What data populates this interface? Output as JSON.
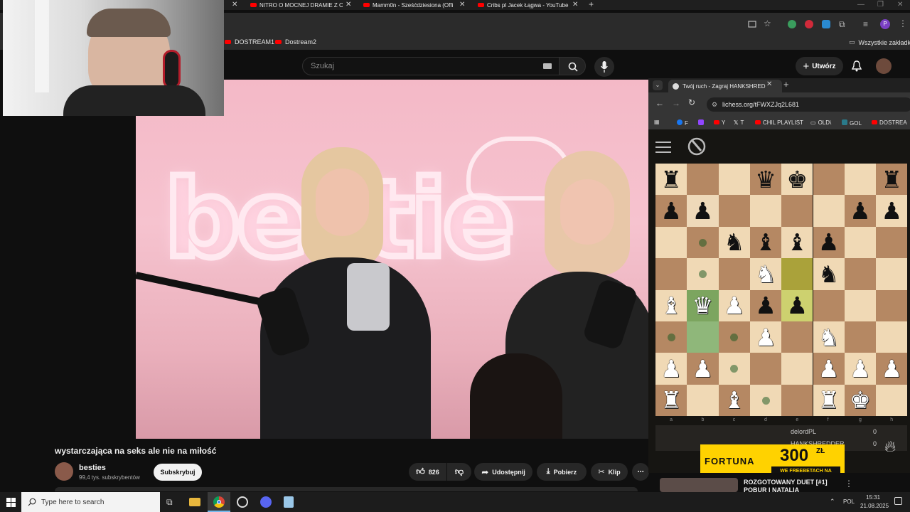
{
  "browser": {
    "tabs": [
      {
        "title": "NITRO O MOCNEJ DRAMIE Z C"
      },
      {
        "title": "Mamm0n - Sześćdziesiona (Offi"
      },
      {
        "title": "Cribs pl Jacek Łągwa - YouTube"
      }
    ],
    "new_tab": "+",
    "bookmarks": [
      "DOSTREAM1",
      "Dostream2"
    ],
    "all_bookmarks": "Wszystkie zakładki"
  },
  "youtube": {
    "search_placeholder": "Szukaj",
    "create_label": "Utwórz",
    "video_title": "wystarczająca na seks ale nie na miłość",
    "video_sign_text": "bestie",
    "channel_name": "besties",
    "channel_subs": "99,4 tys. subskrybentów",
    "subscribe_label": "Subskrybuj",
    "likes": "826",
    "share_label": "Udostępnij",
    "download_label": "Pobierz",
    "clip_label": "Klip",
    "next_video_title": "ROZGOTOWANY DUET [#1]",
    "next_video_sub": "POBUR I NATALIA"
  },
  "lichess": {
    "tab_title": "Twój ruch - Zagraj HANKSHRED",
    "url": "lichess.org/tFWXZJq2L681",
    "bookmarks": [
      "F",
      "Y",
      "T",
      "CHIL PLAYLIST",
      "OLD\\",
      "GOL",
      "DOSTREA"
    ],
    "files": [
      "a",
      "b",
      "c",
      "d",
      "e",
      "f",
      "g",
      "h"
    ],
    "board": [
      [
        "r",
        "",
        "",
        "q",
        "k",
        "",
        "",
        "r"
      ],
      [
        "p",
        "p",
        "",
        "",
        "",
        "",
        "p",
        "p"
      ],
      [
        "",
        "",
        "n",
        "b",
        "b",
        "p",
        "",
        ""
      ],
      [
        "",
        "",
        "",
        "N",
        "",
        "n",
        "",
        ""
      ],
      [
        "B",
        "Q",
        "P",
        "p",
        "p",
        "",
        "",
        ""
      ],
      [
        "",
        "",
        "",
        "P",
        "",
        "N",
        "",
        ""
      ],
      [
        "P",
        "P",
        "",
        "",
        "",
        "P",
        "P",
        "P"
      ],
      [
        "R",
        "",
        "B",
        "",
        "",
        "R",
        "K",
        ""
      ]
    ],
    "highlights": [
      {
        "row": 3,
        "col": 4,
        "color": "#aaa23a"
      },
      {
        "row": 4,
        "col": 4,
        "color": "#cdd16f"
      },
      {
        "row": 4,
        "col": 1,
        "color": "#7ca55f"
      },
      {
        "row": 5,
        "col": 1,
        "color": "#8fb77a"
      },
      {
        "row": 1,
        "col": 1,
        "color": "#eed9b9"
      }
    ],
    "move_dots": [
      {
        "row": 2,
        "col": 1
      },
      {
        "row": 3,
        "col": 1
      },
      {
        "row": 5,
        "col": 0
      },
      {
        "row": 5,
        "col": 2
      },
      {
        "row": 6,
        "col": 2
      },
      {
        "row": 7,
        "col": 3
      }
    ],
    "players": [
      {
        "name": "delordPL",
        "score": "0"
      },
      {
        "name": "HANKSHREDDER",
        "score": "0"
      }
    ],
    "ad_brand": "FORTUNA",
    "ad_bonus": "300",
    "ad_currency": "ZŁ",
    "ad_tagline": "WE FREEBETACH NA START"
  },
  "taskbar": {
    "search_placeholder": "Type here to search",
    "lang": "POL",
    "time": "15:31",
    "date": "21.08.2025"
  },
  "colors": {
    "board_light": "#f0d9b5",
    "board_dark": "#b58863",
    "youtube_red": "#ff0000",
    "fortuna_yellow": "#ffd200"
  }
}
